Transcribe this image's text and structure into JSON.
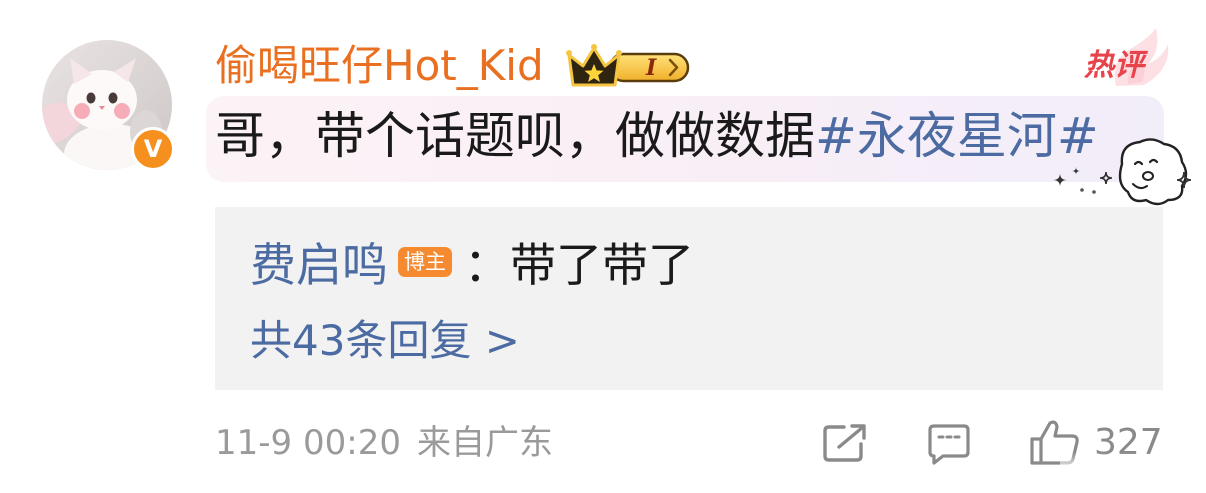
{
  "comment": {
    "author": {
      "name": "偷喝旺仔Hot_Kid",
      "verified_label": "V",
      "level_label": "I"
    },
    "hot_label": "热评",
    "text": "哥，带个话题呗，做做数据",
    "topic": "#永夜星河#",
    "replies": {
      "top_reply": {
        "author": "费启鸣",
        "author_badge": "博主",
        "text": "：带了带了"
      },
      "more_label": "共43条回复 >"
    },
    "meta": {
      "time": "11-9 00:20",
      "location": "来自广东"
    },
    "actions": {
      "like_count": "327"
    }
  },
  "icons": {
    "avatar": "cat-avatar",
    "verified": "verified-v-icon",
    "crown": "crown-icon",
    "hot_decoration": "flame-icon",
    "sticker": "cute-ghost-sticker",
    "share": "share-icon",
    "comment": "comment-icon",
    "like": "thumbs-up-icon"
  },
  "colors": {
    "username": "#ea7021",
    "link": "#4b6ba2",
    "text": "#1a1a1a",
    "meta": "#9a9a9a",
    "hot_label": "#e8434b",
    "badge": "#f58a30",
    "verified_badge": "#f5901f",
    "reply_background": "#f2f2f2",
    "icon": "#8a8a8a"
  }
}
